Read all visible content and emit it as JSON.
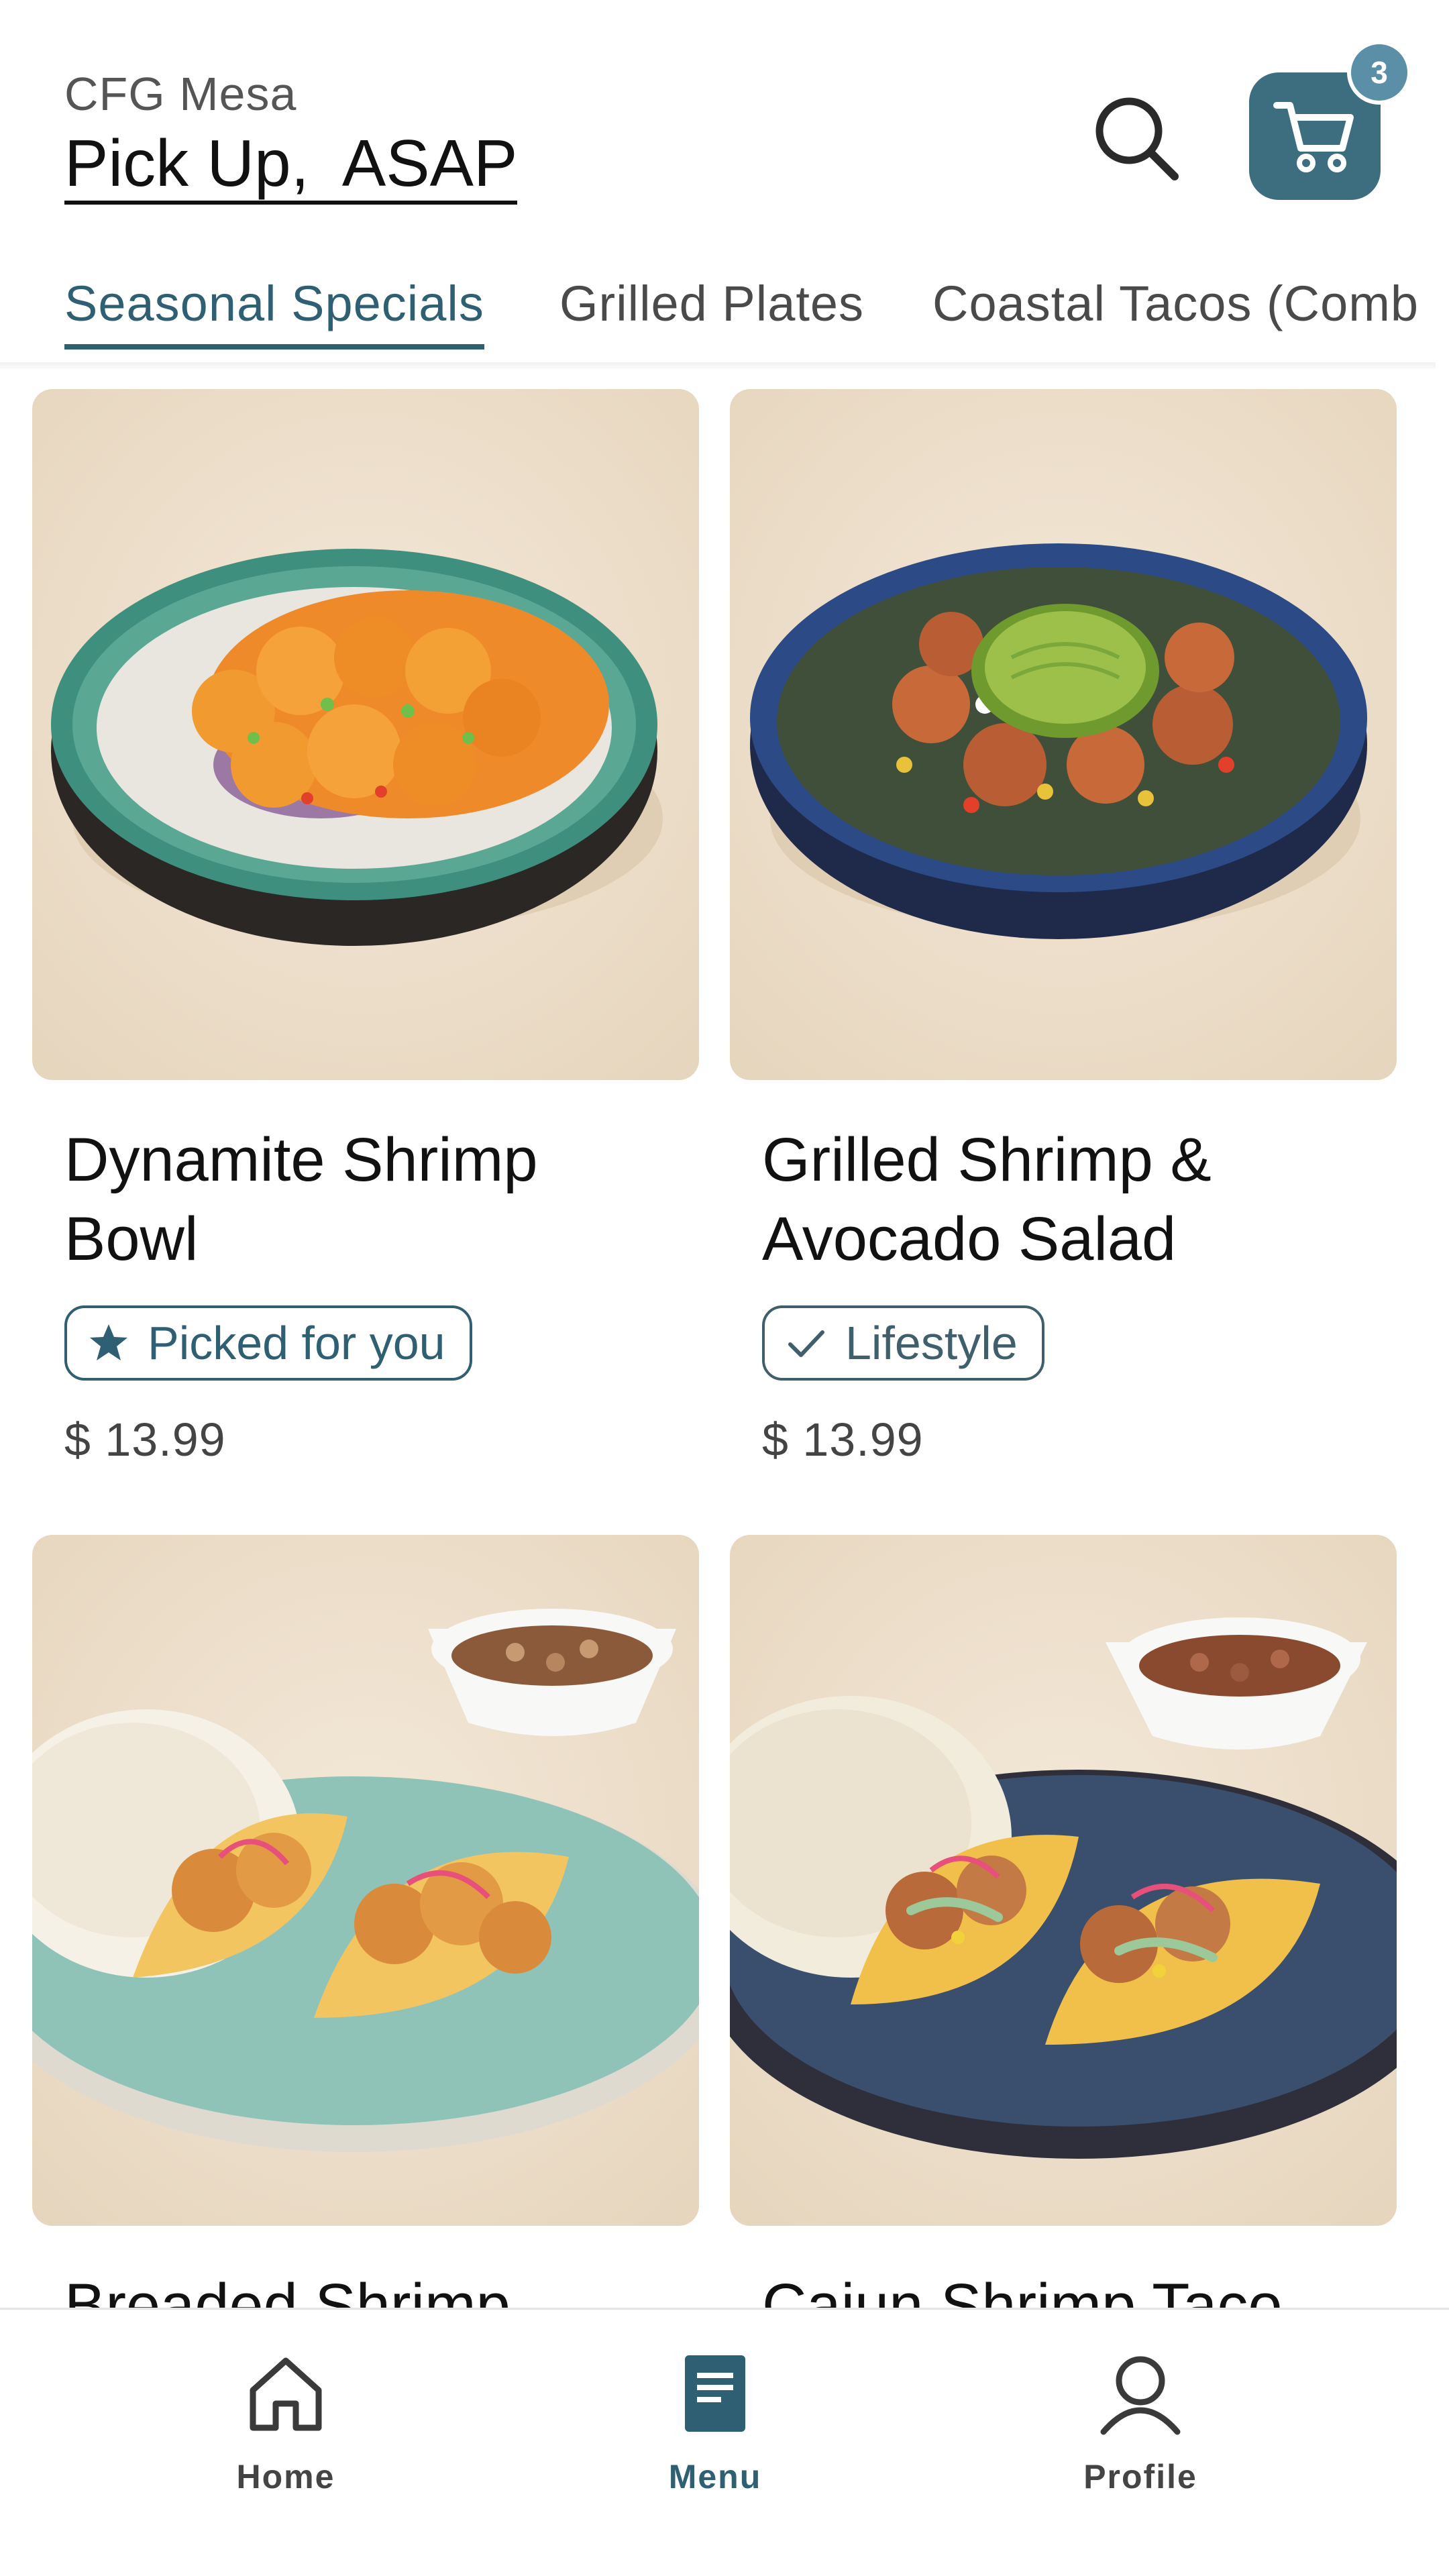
{
  "header": {
    "store_name": "CFG Mesa",
    "pickup_title": "Pick Up,  ASAP",
    "cart_count": "3"
  },
  "tabs": [
    {
      "label": "Seasonal Specials",
      "active": true
    },
    {
      "label": "Grilled Plates",
      "active": false
    },
    {
      "label": "Coastal Tacos (Comb",
      "active": false
    }
  ],
  "menu_items": [
    {
      "title": "Dynamite Shrimp Bowl",
      "tag": "Picked for you",
      "tag_icon": "star-icon",
      "price": "$ 13.99"
    },
    {
      "title": "Grilled Shrimp & Avocado Salad",
      "tag": "Lifestyle",
      "tag_icon": "check-icon",
      "price": "$ 13.99"
    },
    {
      "title": "Breaded Shrimp"
    },
    {
      "title": "Cajun Shrimp Taco"
    }
  ],
  "bottom_nav": [
    {
      "label": "Home",
      "icon": "home-icon",
      "active": false
    },
    {
      "label": "Menu",
      "icon": "menu-book-icon",
      "active": true
    },
    {
      "label": "Profile",
      "icon": "profile-icon",
      "active": false
    }
  ],
  "colors": {
    "accent": "#2f5f73",
    "cart_button": "#3c6e80",
    "badge": "#5b8fa8",
    "image_background": "#efe2cf"
  }
}
